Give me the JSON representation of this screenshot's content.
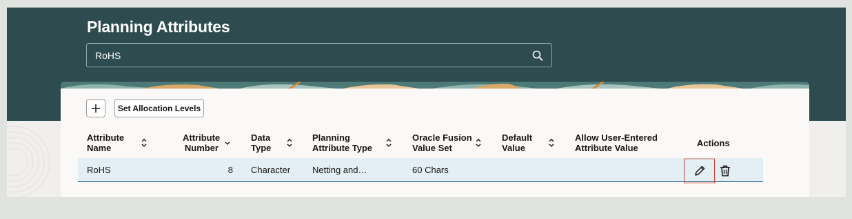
{
  "page": {
    "title": "Planning Attributes"
  },
  "search": {
    "value": "RoHS",
    "icon": "search-icon"
  },
  "toolbar": {
    "add_icon": "plus-icon",
    "set_allocation_label": "Set Allocation Levels"
  },
  "table": {
    "columns": [
      {
        "line1": "Attribute",
        "line2": "Name",
        "sort": "sort-both"
      },
      {
        "line1": "Attribute",
        "line2": "Number",
        "sort": "sort-desc"
      },
      {
        "line1": "Data",
        "line2": "Type",
        "sort": "sort-both"
      },
      {
        "line1": "Planning",
        "line2": "Attribute Type",
        "sort": "sort-both"
      },
      {
        "line1": "Oracle Fusion",
        "line2": "Value Set",
        "sort": "sort-both"
      },
      {
        "line1": "Default",
        "line2": "Value",
        "sort": "sort-both"
      },
      {
        "line1": "Allow User-Entered",
        "line2": "Attribute Value"
      },
      {
        "line1": "Actions",
        "line2": ""
      }
    ],
    "rows": [
      {
        "attribute_name": "RoHS",
        "attribute_number": "8",
        "data_type": "Character",
        "planning_attribute_type": "Netting and…",
        "value_set": "60 Chars",
        "default_value": "",
        "allow_user_entered": ""
      }
    ],
    "actions": {
      "edit_icon": "pencil-icon",
      "delete_icon": "trash-icon"
    }
  },
  "colors": {
    "header_bg": "#2e4c50",
    "row_selected_bg": "#e4eef5",
    "edit_focus_border": "#c74634"
  }
}
